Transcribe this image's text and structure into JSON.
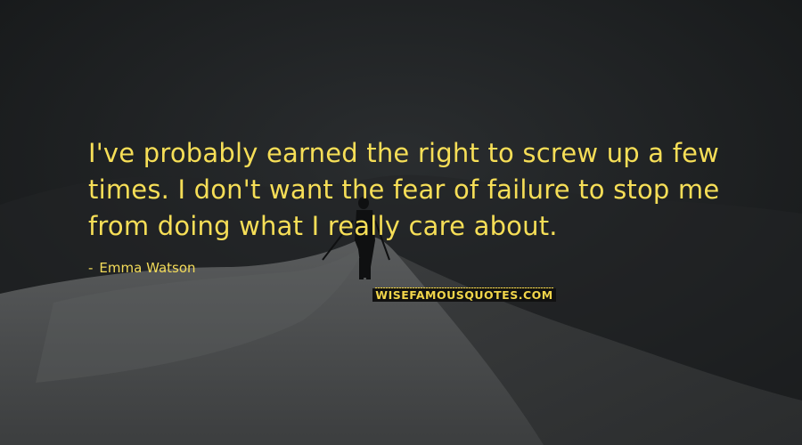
{
  "quote": {
    "lines": [
      "I've probably earned the right to screw up a few",
      "times. I don't want the fear of failure to stop me",
      "from doing what I really care about."
    ]
  },
  "author": {
    "dash": "-",
    "name": "Emma Watson"
  },
  "watermark": {
    "text": "WISEFAMOUSQUOTES.COM"
  },
  "colors": {
    "text": "#f6de57",
    "background": "#1b1d1f",
    "snow": "#4f5152"
  }
}
